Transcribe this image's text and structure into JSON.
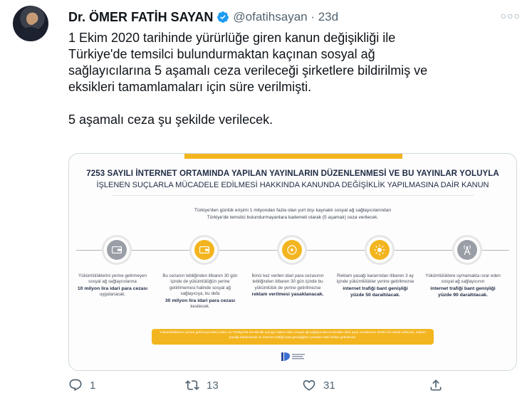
{
  "tweet": {
    "author_name": "Dr. ÖMER FATİH SAYAN",
    "handle_time": "@ofatihsayan · 23d",
    "text_lines": [
      "1 Ekim 2020 tarihinde yürürlüğe giren kanun değişikliği ile",
      "Türkiye'de temsilci bulundurmaktan kaçınan sosyal ağ",
      "sağlayıcılarına 5 aşamalı ceza verileceği şirketlere bildirilmiş ve",
      "eksikleri tamamlamaları için süre verilmişti.",
      "5 aşamalı ceza şu şekilde verilecek."
    ],
    "more_icon": "more-dots-icon",
    "verified_color": "#1d9bf0"
  },
  "card": {
    "title1": "7253 SAYILI İNTERNET ORTAMINDA YAPILAN YAYINLARIN DÜZENLENMESİ VE BU YAYINLAR YOLUYLA",
    "title2": "İŞLENEN SUÇLARLA MÜCADELE EDİLMESİ HAKKINDA KANUNDA DEĞİŞİKLİK YAPILMASINA DAİR KANUN",
    "subtitle_line1": "Türkiye'den günlük erişimi 1 milyondan fazla olan yurt dışı kaynaklı sosyal ağ sağlayıcılarından",
    "subtitle_line2": "Türkiye'de temsilci bulundurmayanlara kademeli olarak (5 aşamalı) ceza verilecek.",
    "steps": [
      {
        "icon": "wallet-icon",
        "color": "#9a9ea6",
        "text_before": "Yükümlülüklerini yerine getirmeyen sosyal ağ sağlayıcılarına",
        "text_bold": "10 milyon lira idari para cezası",
        "text_after": "uygulanacak."
      },
      {
        "icon": "wallet-icon",
        "color": "#f3b51f",
        "text_before": "Bu cezanın tebliğinden itibaren 30 gün içinde de yükümlülüğün yerine getirilmemesi halinde sosyal ağ sağlayıcıya, bu defa",
        "text_bold": "30 milyon lira idari para cezası",
        "text_after": "kesilecek."
      },
      {
        "icon": "play-icon",
        "color": "#f3b51f",
        "text_before": "İkinci kez verilen idari para cezasının tebliğinden itibaren 30 gün içinde bu yükümlülük de yerine getirilmezse",
        "text_bold": "reklam verilmesi yasaklanacak.",
        "text_after": ""
      },
      {
        "icon": "sun-icon",
        "color": "#f3b51f",
        "text_before": "Reklam yasağı kararından itibaren 3 ay içinde yükümlülükler yerine getirilmezse",
        "text_bold": "internet trafiği bant genişliği yüzde 50 daraltılacak.",
        "text_after": ""
      },
      {
        "icon": "antenna-icon",
        "color": "#9a9ea6",
        "text_before": "Yükümlülüklere uymamakta ısrar eden sosyal ağ sağlayıcının",
        "text_bold": "internet trafiği bant genişliği yüzde 90 daraltılacak.",
        "text_after": ""
      }
    ],
    "footer_text": "Yükümlülüklerini yerine getirmeyi kabul eden ve Türkiye'de temsilcilik açmayı kabul eden sosyal ağ sağlayıcılarına kesilen idari para cezalarının dörtte biri tahsil edilecek, reklam yasağı kaldırılacak ve internet trafiği bant genişliğinin yeniden eski haline getirilecek.",
    "accent_color": "#f3b51f"
  },
  "actions": {
    "reply_count": "1",
    "retweet_count": "13",
    "like_count": "31"
  }
}
